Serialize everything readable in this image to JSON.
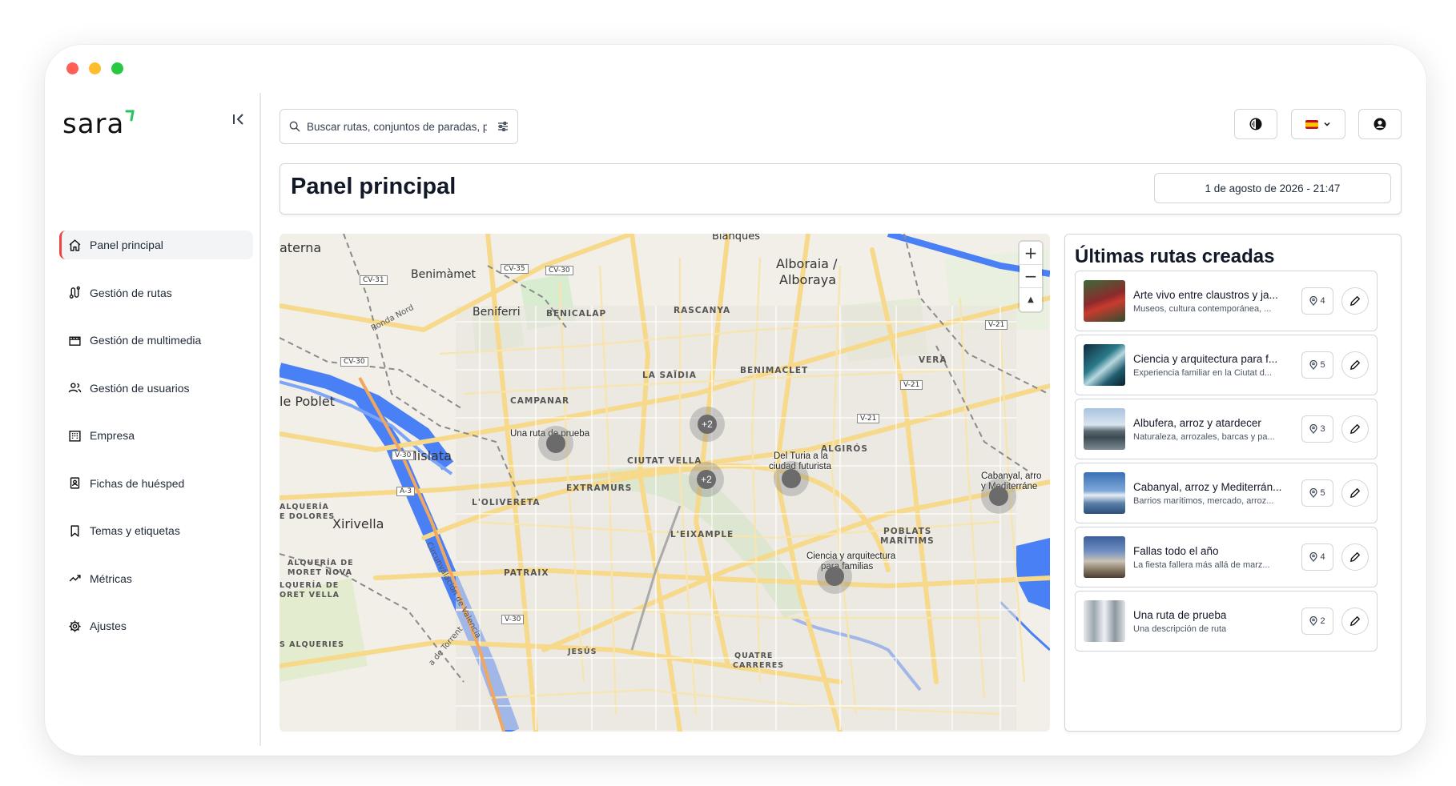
{
  "app": {
    "logo_text": "sara"
  },
  "sidebar": {
    "items": [
      {
        "label": "Panel principal",
        "icon": "home-icon",
        "active": true
      },
      {
        "label": "Gestión de rutas",
        "icon": "route-icon"
      },
      {
        "label": "Gestión de multimedia",
        "icon": "clapperboard-icon"
      },
      {
        "label": "Gestión de usuarios",
        "icon": "users-icon"
      },
      {
        "label": "Empresa",
        "icon": "building-icon"
      },
      {
        "label": "Fichas de huésped",
        "icon": "guest-card-icon"
      },
      {
        "label": "Temas y etiquetas",
        "icon": "bookmark-icon"
      },
      {
        "label": "Métricas",
        "icon": "trend-icon"
      },
      {
        "label": "Ajustes",
        "icon": "gear-icon"
      }
    ]
  },
  "search": {
    "placeholder": "Buscar rutas, conjuntos de paradas, p"
  },
  "header": {
    "title": "Panel principal",
    "datetime": "1 de agosto de 2026 - 21:47"
  },
  "map": {
    "zoom_in": "+",
    "zoom_out": "−",
    "reset": "▲",
    "labels": {
      "paterna": "aterna",
      "benimamet": "Benimàmet",
      "beniferri": "Beniferri",
      "benicalap": "BENICALAP",
      "rascanya": "RASCANYA",
      "alboraia": "Alboraia /",
      "alboraya": "Alboraya",
      "blanques": "Blanques",
      "la_saidia": "LA SAÏDIA",
      "benimaclet": "BENIMACLET",
      "vera": "VERA",
      "campanar": "CAMPANAR",
      "poblet": "le Poblet",
      "mislata": "Mislata",
      "ciutat_vella": "CIUTAT VELLA",
      "extramurs": "EXTRAMURS",
      "olivereta": "L'OLIVERETA",
      "algiros": "ALGIRÓS",
      "xirivella": "Xirivella",
      "eixample": "L'EIXAMPLE",
      "poblats_1": "POBLATS",
      "poblats_2": "MARÍTIMS",
      "alqueria_1": "ALQUERÍA",
      "alqueria_2": "E DOLORES",
      "patraix": "PATRAIX",
      "moret_1": "ALQUERÍA DE",
      "moret_2": "MORET NOVA",
      "moret_3": "LQUERÍA DE",
      "moret_4": "ORET VELLA",
      "jesus": "JESÚS",
      "quatre": "QUATRE",
      "carreres": "CARRERES",
      "alqueries": "S ALQUERIES",
      "randa": "Ronda Nord",
      "circ": "Circunvalación de Valencia",
      "torrent": "a de Torrent"
    },
    "roads": [
      "CV-35",
      "CV-30",
      "CV-31",
      "CV-30",
      "V-21",
      "V-21",
      "V-21",
      "V-30",
      "A-3",
      "V-30"
    ],
    "poi_labels": {
      "prueba": "Una ruta de prueba",
      "turia_1": "Del Turia a la",
      "turia_2": "ciudad futurista",
      "cabanyal_1": "Cabanyal, arro",
      "cabanyal_2": "y Mediterráne",
      "ciencia_1": "Ciencia y arquitectura",
      "ciencia_2": "para familias"
    },
    "clusters": [
      "+2",
      "+2"
    ]
  },
  "routes": {
    "title": "Últimas rutas creadas",
    "items": [
      {
        "name": "Arte vivo entre claustros y ja...",
        "description": "Museos, cultura contemporánea, ...",
        "stops": "4"
      },
      {
        "name": "Ciencia y arquitectura para f...",
        "description": "Experiencia familiar en la Ciutat d...",
        "stops": "5"
      },
      {
        "name": "Albufera, arroz y atardecer",
        "description": "Naturaleza, arrozales, barcas y pa...",
        "stops": "3"
      },
      {
        "name": "Cabanyal, arroz y Mediterrán...",
        "description": "Barrios marítimos, mercado, arroz...",
        "stops": "5"
      },
      {
        "name": "Fallas todo el año",
        "description": "La fiesta fallera más allá de marz...",
        "stops": "4"
      },
      {
        "name": "Una ruta de prueba",
        "description": "Una descripción de ruta",
        "stops": "2"
      }
    ]
  },
  "colors": {
    "accent": "#ef4444",
    "logo_mark": "#22c55e",
    "river": "#4a80f5",
    "road": "#f7d98b"
  }
}
